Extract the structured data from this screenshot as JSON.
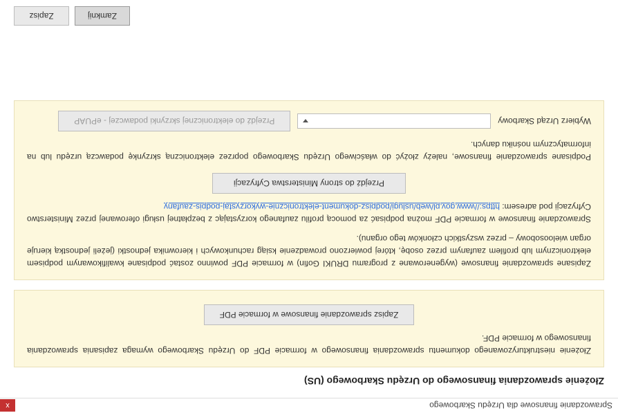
{
  "window": {
    "title": "Sprawozdanie finansowe dla Urzędu Skarbowego",
    "close_label": "x"
  },
  "heading": "Złożenie sprawozdania finansowego do Urzędu Skarbowego (US)",
  "panel1": {
    "text": "Złożenie niestrukturyzowanego dokumentu sprawozdania finansowego w formacie PDF do Urzędu Skarbowego wymaga zapisania sprawozdania finansowego w formacie PDF.",
    "button": "Zapisz sprawozdanie finansowe w formacie PDF"
  },
  "panel2": {
    "para1": "Zapisane sprawozdanie finansowe (wygenerowane z programu DRUKI Gofin) w formacie PDF powinno zostać podpisane kwalifikowanym podpisem elektronicznym lub profilem zaufanym przez osobę, której powierzono prowadzenie ksiąg rachunkowych i kierownika jednostki (jeżeli jednostką kieruje organ wieloosobowy – przez wszystkich członków tego organu).",
    "para2_prefix": "Sprawozdanie finansowe w formacie PDF można podpisać za pomocą profilu zaufanego korzystając z bezpłatnej usługi oferowanej przez Ministerstwo Cyfryzacji pod adresem: ",
    "link": "https://www.gov.pl/web/uslugi/podpisz-dokument-elektronicznie-wykorzystaj-podpis-zaufany",
    "button": "Przejdź do strony Ministerstwa Cyfryzacji",
    "para3": "Podpisane sprawozdanie finansowe, należy złożyć do właściwego Urzędu Skarbowego poprzez elektroniczną skrzynkę podawczą urzędu lub na informatycznym nośniku danych.",
    "select_label": "Wybierz Urząd Skarbowy",
    "select_value": "",
    "epuap_button": "Przejdź do elektronicznej skrzynki podawczej - ePUAP"
  },
  "footer": {
    "close": "Zamknij",
    "save": "Zapisz"
  }
}
